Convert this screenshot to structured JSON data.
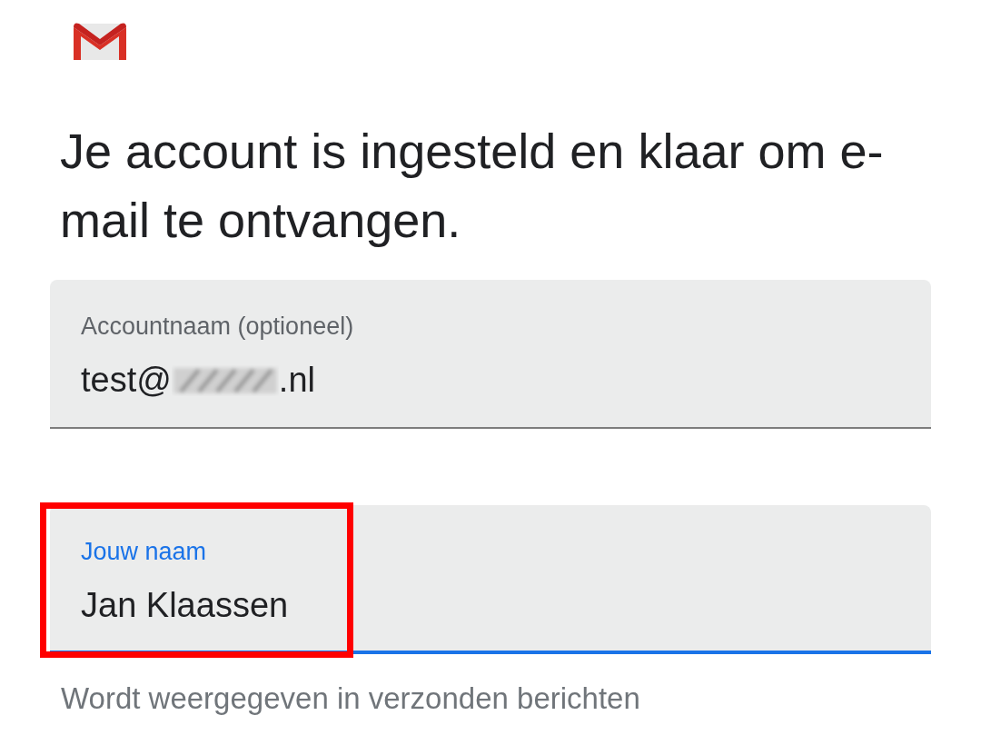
{
  "heading": "Je account is ingesteld en klaar om e-mail te ontvangen.",
  "fields": [
    {
      "label": "Accountnaam (optioneel)",
      "value_prefix": "test@",
      "value_suffix": ".nl",
      "redacted": true,
      "focused": false,
      "highlighted": false
    },
    {
      "label": "Jouw naam",
      "value_prefix": "Jan Klaassen",
      "focused": true,
      "highlighted": true,
      "helper": "Wordt weergegeven in verzonden berichten"
    }
  ]
}
